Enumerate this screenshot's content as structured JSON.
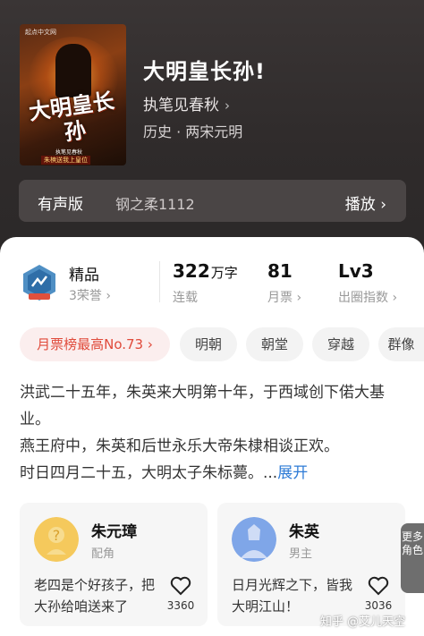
{
  "book": {
    "title": "大明皇长孙!",
    "author": "执笔见春秋",
    "author_chevron": "›",
    "category": "历史 · 两宋元明"
  },
  "cover": {
    "publisher": "起点中文网",
    "title": "大明皇长孙",
    "author": "执笔见春秋",
    "slogan": "朱樉送我上皇位"
  },
  "audio": {
    "label": "有声版",
    "narrator": "钢之柔1112",
    "play": "播放 ›"
  },
  "stats": {
    "badge_label": "精品",
    "honors": "3荣誉 ›",
    "word_count_num": "322",
    "word_count_unit": "万字",
    "status": "连载",
    "monthly_tickets": "81",
    "monthly_tickets_label": "月票 ›",
    "level": "Lv3",
    "level_label": "出圈指数 ›"
  },
  "tags": [
    "月票榜最高No.73 ›",
    "明朝",
    "朝堂",
    "穿越",
    "群像"
  ],
  "description": {
    "line1": "洪武二十五年，朱英来大明第十年，于西域创下偌大基业。",
    "line2": "燕王府中，朱英和后世永乐大帝朱棣相谈正欢。",
    "line3": "时日四月二十五，大明太子朱标薨。...",
    "expand": "展开"
  },
  "characters": [
    {
      "name": "朱元璋",
      "role": "配角",
      "quote": "老四是个好孩子，把大孙给咱送来了",
      "likes": "3360"
    },
    {
      "name": "朱英",
      "role": "男主",
      "quote": "日月光辉之下，皆我大明江山！",
      "likes": "3036"
    }
  ],
  "more_tab": "更多角色",
  "watermark": "知乎 @艾儿天空",
  "colors": {
    "accent_red": "#e04a3a",
    "link_blue": "#2e7bd6",
    "hero_bg": "#332f2f"
  },
  "icons": {
    "badge": "quality-badge-icon",
    "heart": "heart-icon",
    "chevron": "chevron-right-icon"
  }
}
